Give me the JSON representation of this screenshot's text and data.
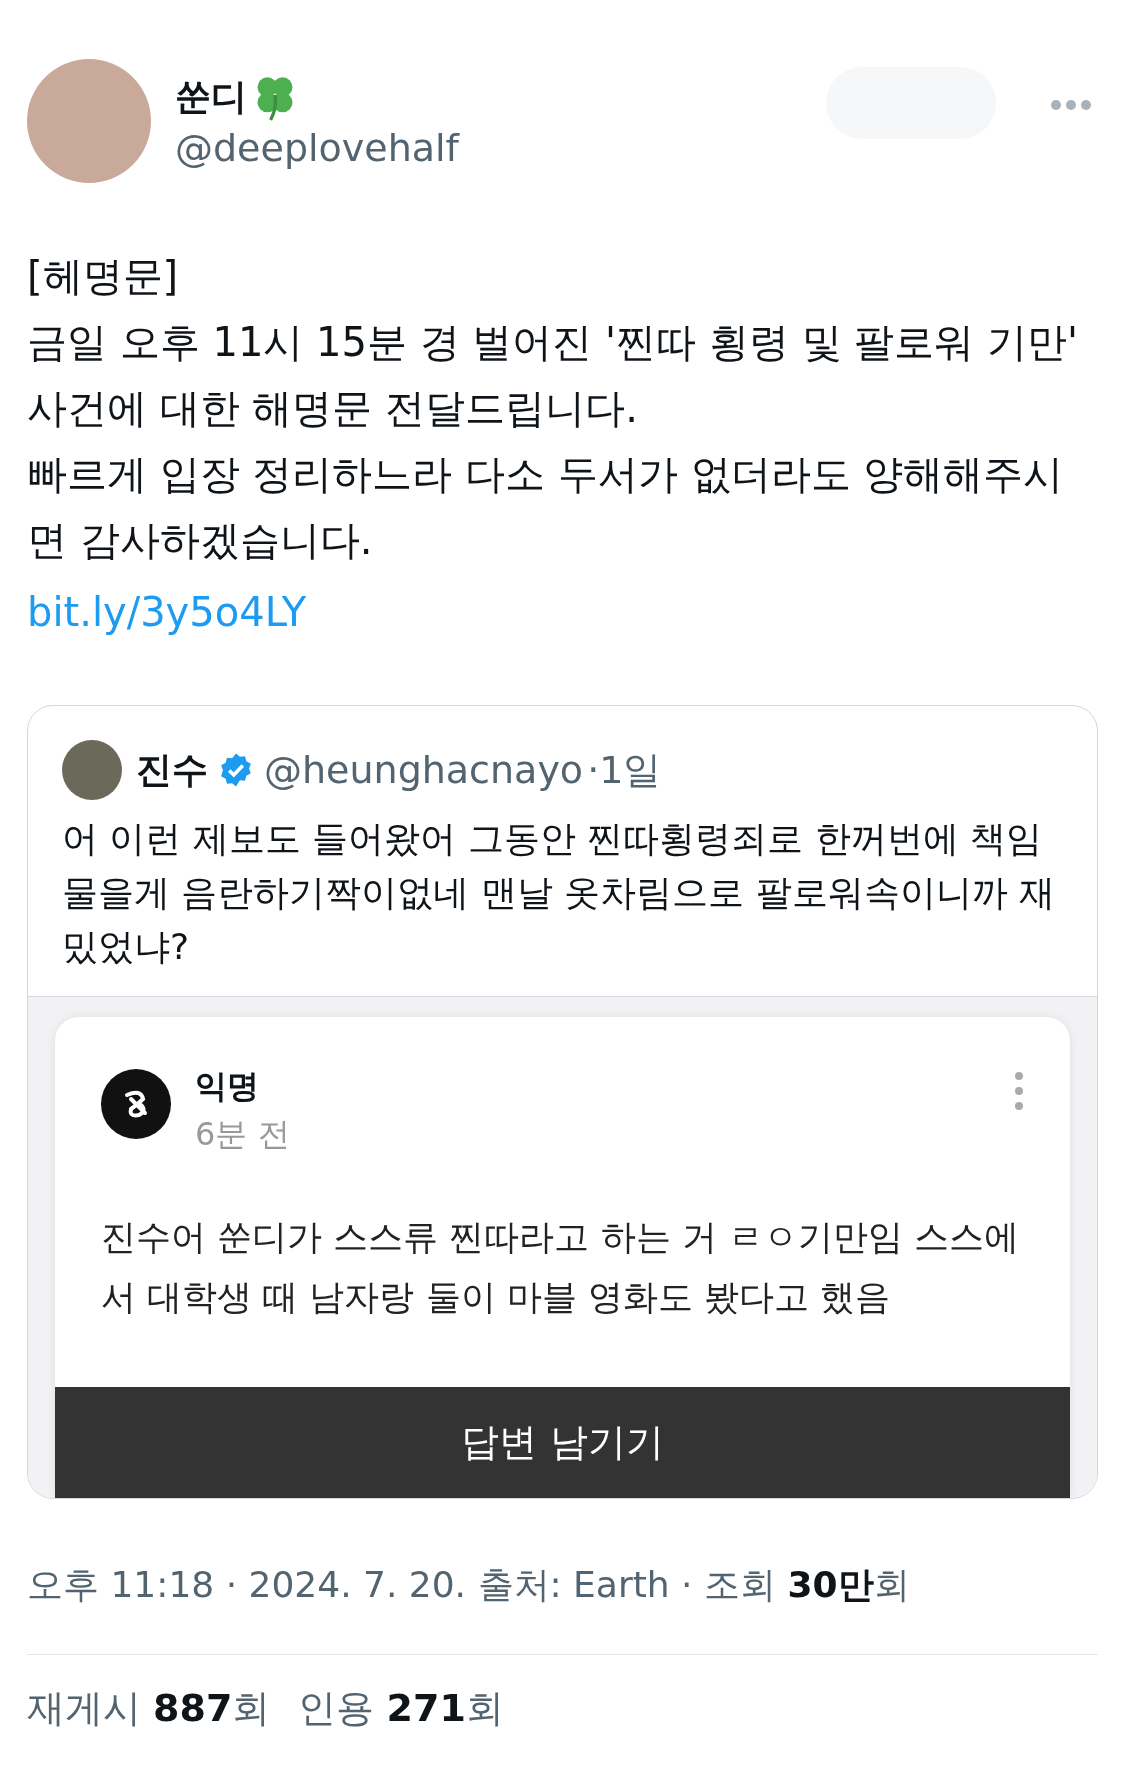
{
  "author": {
    "name": "쑨디",
    "handle": "@deeplovehalf"
  },
  "tweet": {
    "text": "[헤명문]\n금일 오후 11시 15분 경 벌어진 '찐따 횡령 및 팔로워 기만' 사건에 대한 해명문 전달드립니다.\n빠르게 입장 정리하느라 다소 두서가 없더라도 양해해주시면 감사하겠습니다.",
    "link": "bit.ly/3y5o4LY"
  },
  "quote": {
    "name": "진수",
    "verified": true,
    "handle": "@heunghacnayo",
    "time": "·1일",
    "text": "어 이런 제보도 들어왔어 그동안 찐따횡령죄로 한꺼번에 책임 물을게 음란하기짝이없네 맨날 옷차림으로 팔로워속이니까 재밌었냐?",
    "post": {
      "author": "익명",
      "time": "6분 전",
      "text": "진수어 쑨디가 스스류 찐따라고 하는 거 ㄹㅇ기만임 스스에서 대학생 때 남자랑 둘이 마블 영화도 봤다고 했음",
      "button": "답변 남기기"
    }
  },
  "meta": "오후 11:18 · 2024. 7. 20. 출처: Earth · 조회 **30만**회",
  "stats": [
    "재게시 **887**회",
    "인용 **271**회"
  ]
}
